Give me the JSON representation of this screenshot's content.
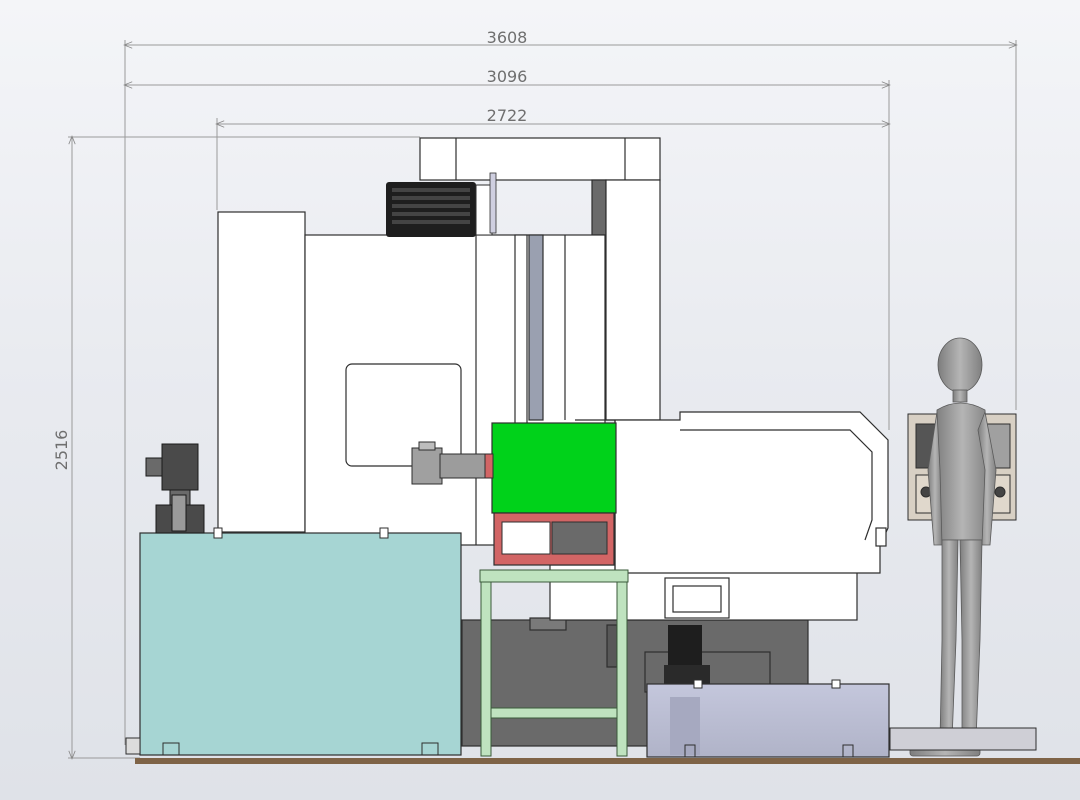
{
  "dimensions": {
    "overall_width": "3608",
    "middle_width": "3096",
    "machine_width": "2722",
    "height": "2516"
  },
  "colors": {
    "frame_white": "#ffffff",
    "outline": "#2e2e2e",
    "coolant_tank": "#a6d5d3",
    "hopper_green": "#00d21a",
    "frame_red": "#d26565",
    "stand_green": "#bfe3bf",
    "base_grey": "#6a6a6a",
    "chip_tank": "#b8bacf",
    "motor_black": "#1e1e1e",
    "mannequin": "#9a9a9a",
    "floor": "#8a6a4a"
  }
}
